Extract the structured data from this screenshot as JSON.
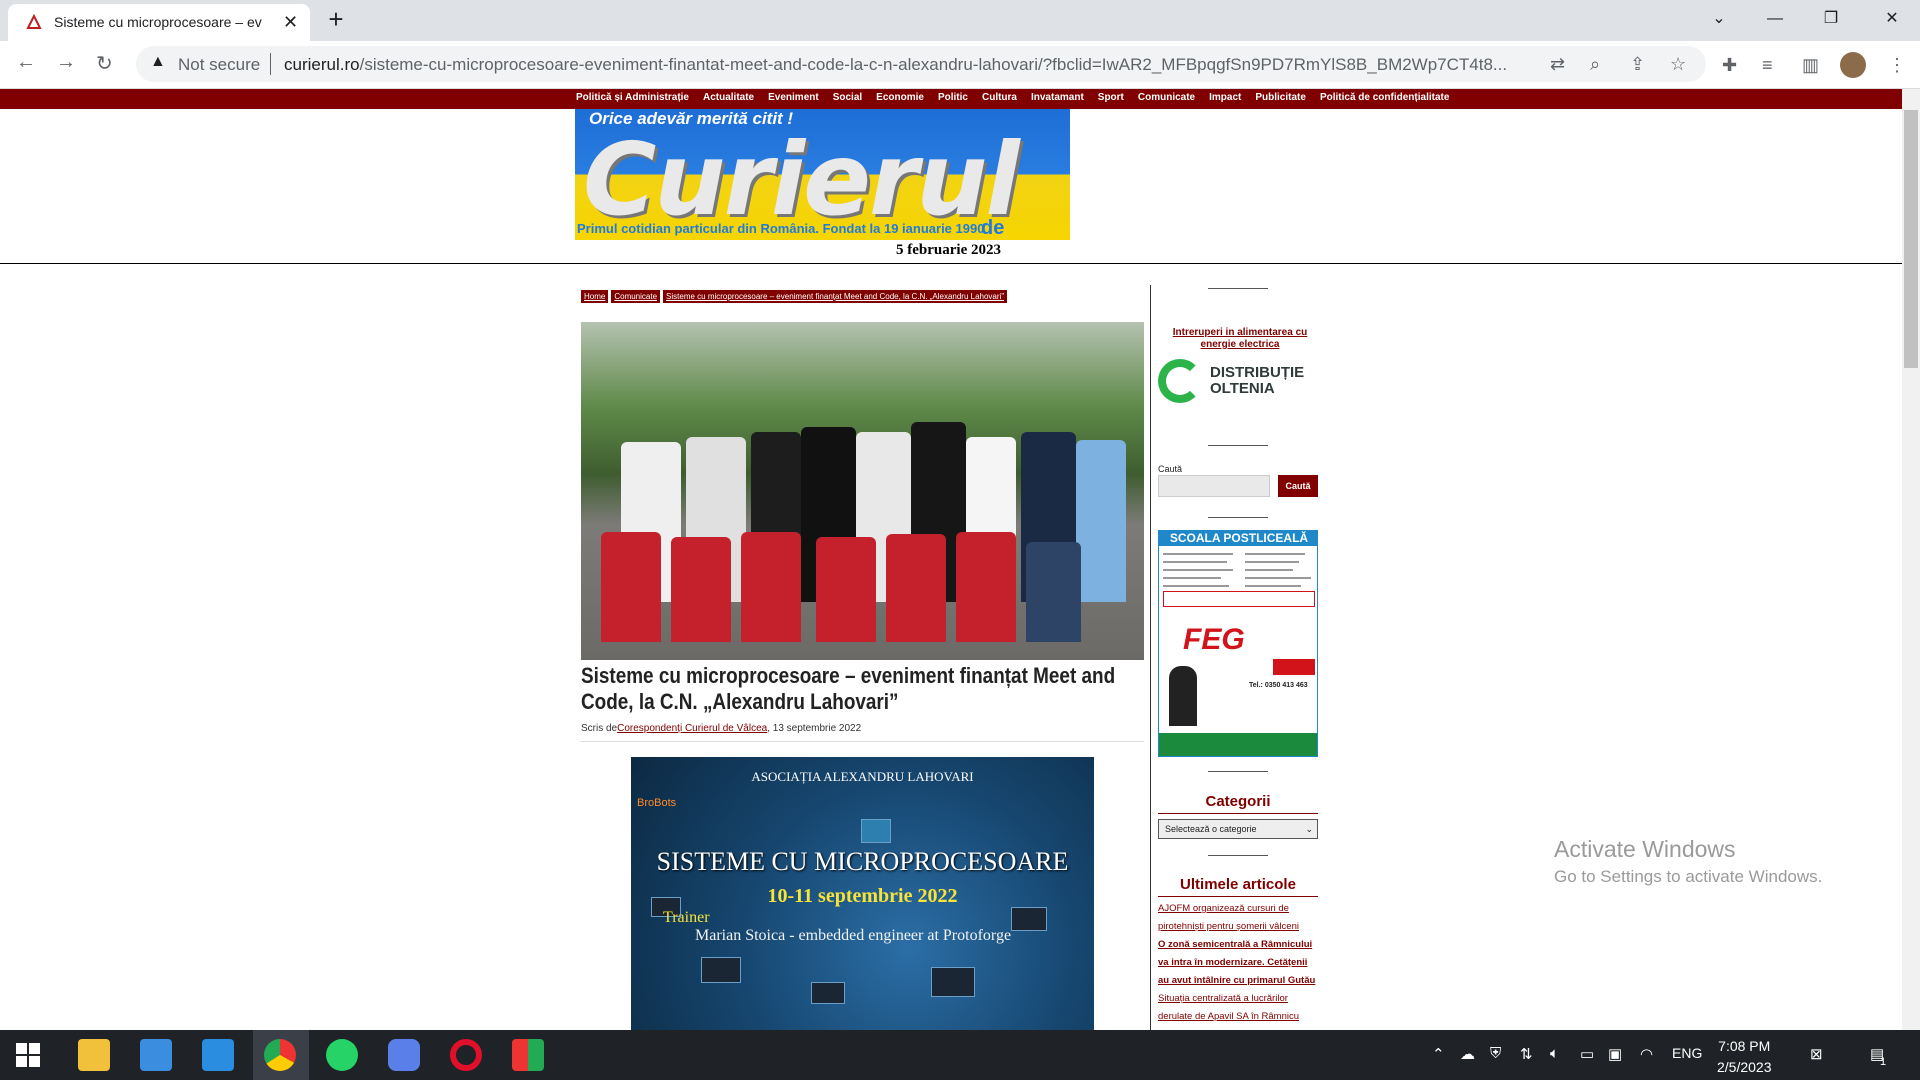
{
  "browser": {
    "tab_title": "Sisteme cu microprocesoare – ev",
    "new_tab": "+",
    "not_secure": "Not secure",
    "url_domain": "curierul.ro",
    "url_path": "/sisteme-cu-microprocesoare-eveniment-finantat-meet-and-code-la-c-n-alexandru-lahovari/?fbclid=IwAR2_MFBpqgfSn9PD7RmYlS8B_BM2Wp7CT4t8..."
  },
  "site": {
    "nav": [
      "Politică și Administrație",
      "Actualitate",
      "Eveniment",
      "Social",
      "Economie",
      "Politic",
      "Cultura",
      "Invatamant",
      "Sport",
      "Comunicate",
      "Impact",
      "Publicitate",
      "Politică de confidențialitate"
    ],
    "logo_tagline": "Orice adevăr merită citit !",
    "logo_name": "Curierul",
    "logo_sub": "Primul cotidian particular din România. Fondat la 19 ianuarie 1990",
    "logo_de_valcea": "de Vâlcea",
    "date": "5 februarie 2023"
  },
  "breadcrumb": [
    "Home",
    "Comunicate",
    "Sisteme cu microprocesoare – eveniment finanțat Meet and Code, la C.N. „Alexandru Lahovari”"
  ],
  "article": {
    "title": "Sisteme cu microprocesoare – eveniment finanțat Meet and Code, la C.N. „Alexandru Lahovari”",
    "byline_prefix": "Scris de",
    "author": "Corespondenți Curierul de Vâlcea",
    "date": ", 13 septembrie 2022"
  },
  "poster": {
    "org": "ASOCIAȚIA ALEXANDRU LAHOVARI",
    "brand": "BroBots",
    "title": "SISTEME CU MICROPROCESOARE",
    "dates": "10-11 septembrie 2022",
    "trainer_label": "Trainer",
    "trainer_name": "Marian Stoica - embedded engineer at Protoforge"
  },
  "sidebar": {
    "power_link": "Intreruperi in alimentarea cu energie electrica",
    "distributie": "DISTRIBUȚIE",
    "oltenia": "OLTENIA",
    "search_label": "Caută",
    "search_button": "Caută",
    "ad_header": "SCOALA POSTLICEALĂ",
    "ad_brand": "FEG",
    "ad_phone": "Tel.: 0350 413 463",
    "categorii": "Categorii",
    "category_select": "Selectează o categorie",
    "ultimele": "Ultimele articole",
    "posts": [
      "AJOFM organizează cursuri de pirotehniști pentru șomerii vâlceni",
      "O zonă semicentrală a Râmnicului va intra în modernizare. Cetățenii au avut întâlnire cu primarul Gutău",
      "Situația centralizată a lucrărilor derulate de Apavil SA în Râmnicu"
    ]
  },
  "watermark": {
    "line1": "Activate Windows",
    "line2": "Go to Settings to activate Windows."
  },
  "taskbar": {
    "lang": "ENG",
    "time": "7:08 PM",
    "date": "2/5/2023",
    "notif": "1"
  }
}
